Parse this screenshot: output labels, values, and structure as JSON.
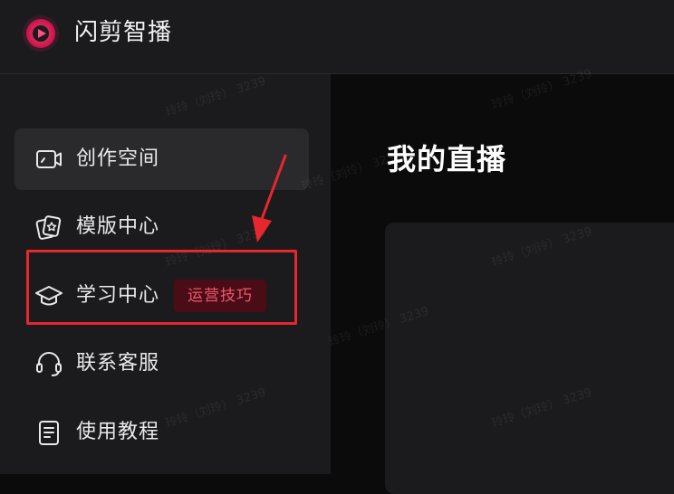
{
  "app": {
    "title": "闪剪智播",
    "logo": "app-logo-icon"
  },
  "sidebar": {
    "items": [
      {
        "label": "创作空间",
        "icon": "video-camera-icon",
        "active": true
      },
      {
        "label": "模版中心",
        "icon": "template-cards-icon",
        "active": false
      },
      {
        "label": "学习中心",
        "icon": "graduation-cap-icon",
        "active": false,
        "badge": "运营技巧"
      },
      {
        "label": "联系客服",
        "icon": "headset-icon",
        "active": false
      },
      {
        "label": "使用教程",
        "icon": "document-icon",
        "active": false
      }
    ]
  },
  "main": {
    "title": "我的直播"
  },
  "watermark": {
    "text": "玲玲（刘玲） 3239"
  },
  "colors": {
    "background": "#0b0b0c",
    "panel": "#1b1b1d",
    "active_item": "#2a2a2d",
    "badge_bg": "#4a0d16",
    "badge_text": "#f0566e",
    "annotation": "#e8262e",
    "logo_gradient": [
      "#ff2d7a",
      "#ff6a2a"
    ]
  }
}
